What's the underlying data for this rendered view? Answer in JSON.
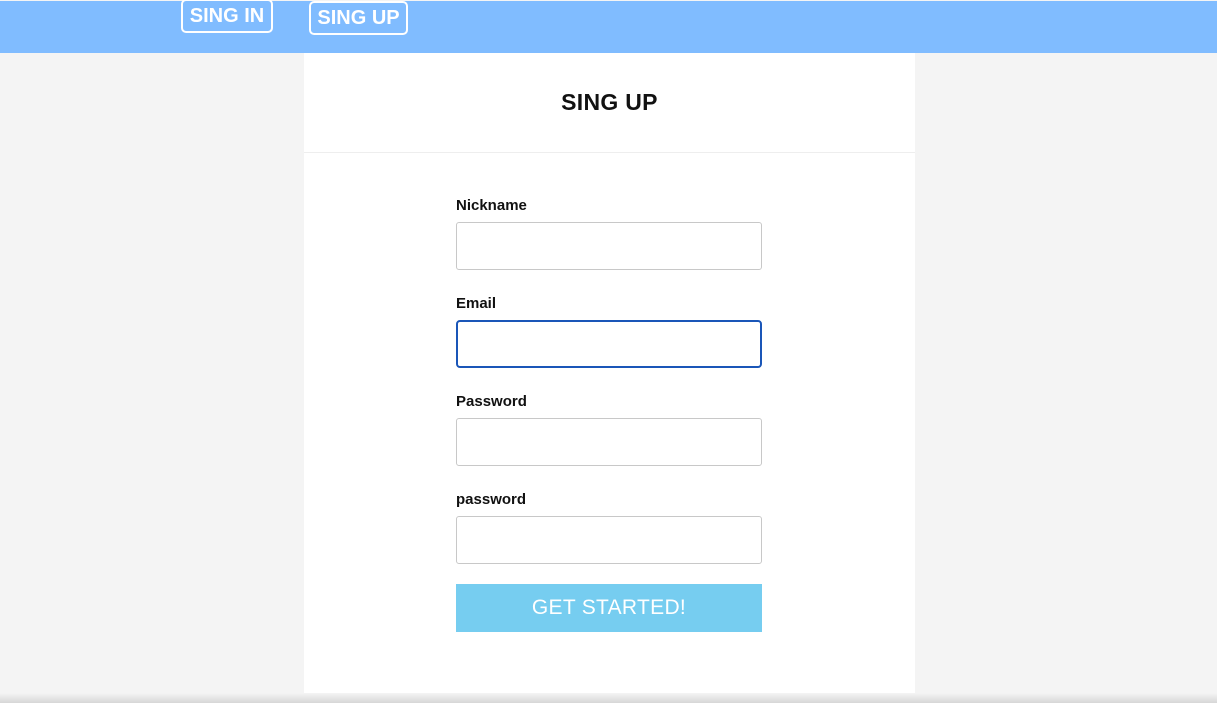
{
  "nav": {
    "signin_label": "SING IN",
    "signup_label": "SING UP"
  },
  "panel": {
    "title": "SING UP"
  },
  "form": {
    "fields": [
      {
        "label": "Nickname",
        "value": ""
      },
      {
        "label": "Email",
        "value": ""
      },
      {
        "label": "Password",
        "value": ""
      },
      {
        "label": "password",
        "value": ""
      }
    ],
    "submit_label": "GET STARTED!"
  },
  "colors": {
    "navbar": "#80bcff",
    "button": "#76cdf0",
    "focus_border": "#1a56b8"
  }
}
